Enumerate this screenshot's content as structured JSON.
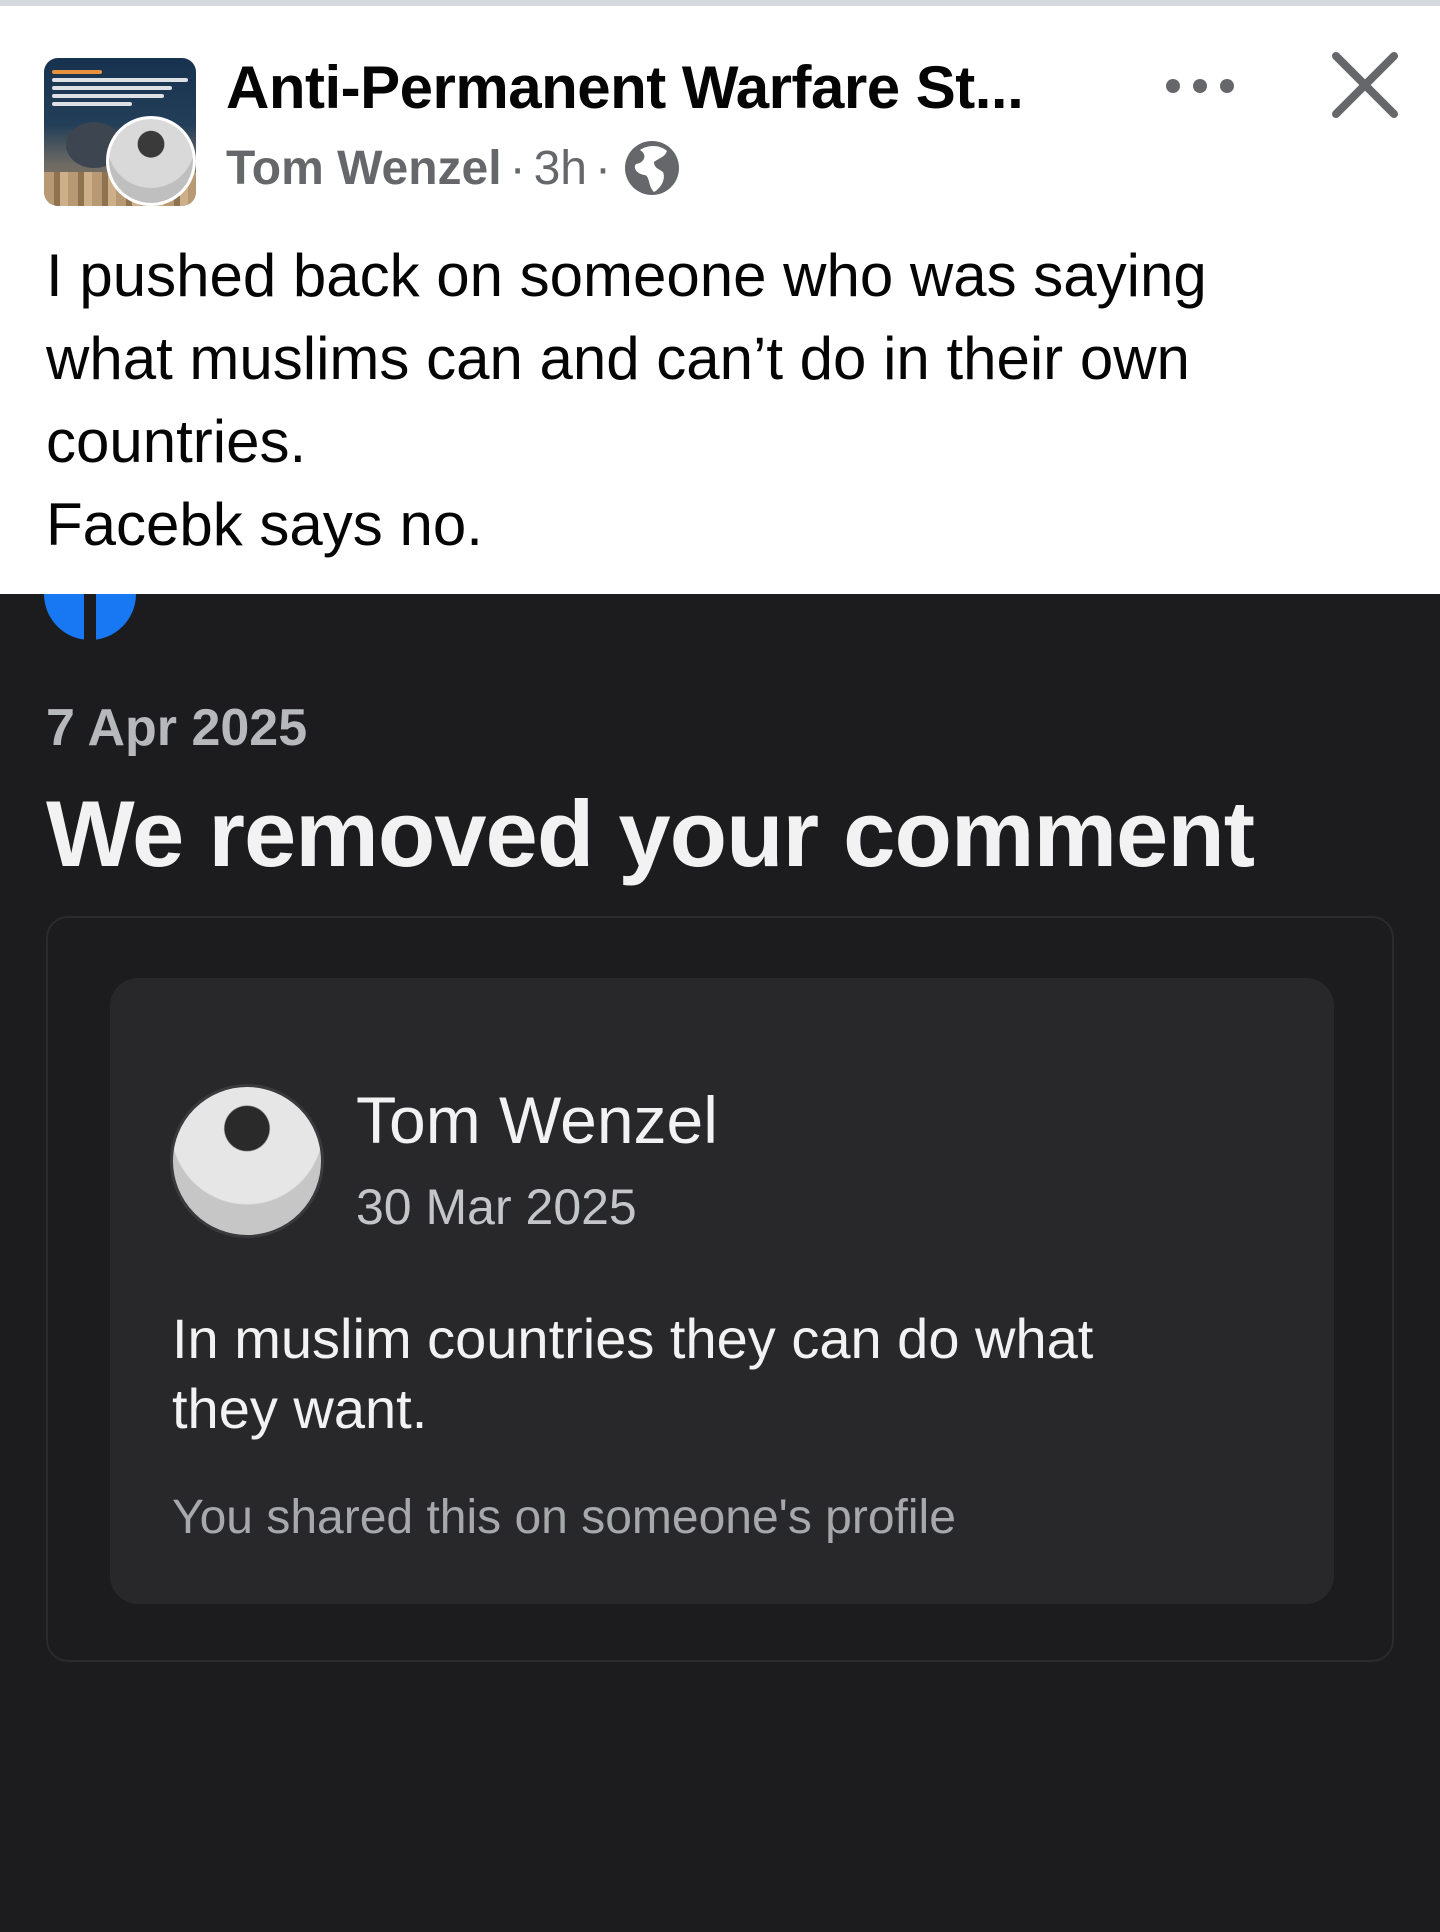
{
  "post": {
    "group_name": "Anti-Permanent Warfare St...",
    "author": "Tom Wenzel",
    "separator": "·",
    "time": "3h",
    "audience_icon": "globe-icon",
    "more_icon": "more-horizontal-icon",
    "close_icon": "close-icon",
    "lines": [
      "I pushed back on someone who was saying",
      "what muslims can and can’t do in their own",
      "countries.",
      "Facebk says no."
    ]
  },
  "screenshot": {
    "brand_icon": "facebook-icon",
    "date": "7 Apr 2025",
    "title": "We removed your comment",
    "comment": {
      "author": "Tom Wenzel",
      "date": "30 Mar 2025",
      "lines": [
        "In muslim countries they can do what",
        "they want."
      ],
      "note": "You shared this on someone's profile"
    }
  },
  "colors": {
    "post_background": "#ffffff",
    "post_text": "#050505",
    "secondary_text": "#65676b",
    "dark_background": "#1c1c1e",
    "card_background": "#28282b",
    "facebook_blue": "#1877f2"
  }
}
